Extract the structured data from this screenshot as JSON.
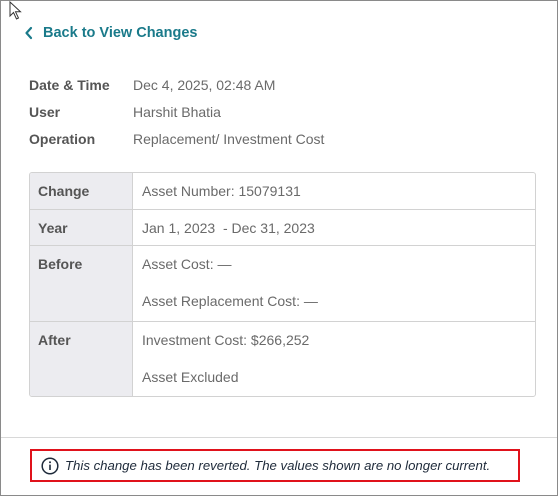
{
  "back_link": {
    "label": "Back to View Changes",
    "icon": "chevron-left-icon"
  },
  "meta": [
    {
      "key": "Date & Time",
      "value": "Dec 4, 2025, 02:48 AM"
    },
    {
      "key": "User",
      "value": "Harshit Bhatia"
    },
    {
      "key": "Operation",
      "value": "Replacement/ Investment Cost"
    }
  ],
  "table": {
    "change": {
      "key": "Change",
      "value": "Asset Number: 15079131"
    },
    "year": {
      "key": "Year",
      "value": "Jan 1, 2023  - Dec 31, 2023"
    },
    "before": {
      "key": "Before",
      "lines": [
        "Asset Cost: —",
        "Asset Replacement Cost: —"
      ]
    },
    "after": {
      "key": "After",
      "lines": [
        "Investment Cost: $266,252",
        "Asset Excluded"
      ]
    }
  },
  "notice": {
    "text": "This change has been reverted. The values shown are no longer current.",
    "icon": "info-icon",
    "highlight_color": "#e0121b"
  },
  "colors": {
    "accent": "#1a7a8a",
    "label_bg": "#ececf0"
  }
}
